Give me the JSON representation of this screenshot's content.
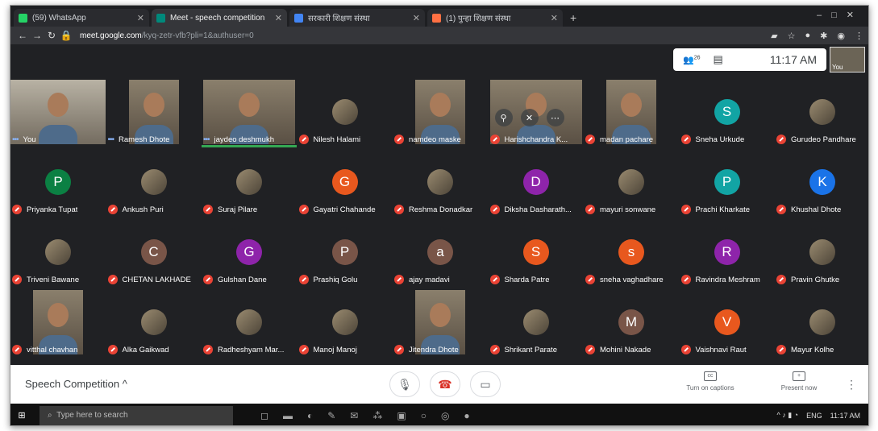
{
  "browser": {
    "tabs": [
      {
        "label": "(59) WhatsApp",
        "color": "#25d366",
        "active": false
      },
      {
        "label": "Meet - speech competition",
        "color": "#00897b",
        "active": true
      },
      {
        "label": "सरकारी शिक्षण संस्था",
        "color": "#4285f4",
        "active": false
      },
      {
        "label": "(1) पुन्हा शिक्षण संस्था",
        "color": "#ff7043",
        "active": false
      }
    ],
    "url_host": "meet.google.com",
    "url_path": "/kyq-zetr-vfb?pli=1&authuser=0"
  },
  "meet": {
    "participant_count": "26",
    "time": "11:17 AM",
    "self_label": "You",
    "meeting_name": "Speech Competition",
    "captions_label": "Turn on captions",
    "present_label": "Present now"
  },
  "participants": [
    {
      "name": "You",
      "kind": "video-wide",
      "status": "dots"
    },
    {
      "name": "Ramesh Dhote",
      "kind": "video",
      "status": "dots"
    },
    {
      "name": "jaydeo deshmukh",
      "kind": "video-mid",
      "status": "dots",
      "speaking": true
    },
    {
      "name": "Nilesh Halami",
      "kind": "avatar-pic",
      "status": "muted"
    },
    {
      "name": "namdeo maske",
      "kind": "video",
      "status": "muted"
    },
    {
      "name": "Harishchandra K...",
      "kind": "video-mid",
      "status": "muted",
      "hover": true
    },
    {
      "name": "madan pachare",
      "kind": "video",
      "status": "muted"
    },
    {
      "name": "Sneha Urkude",
      "kind": "avatar",
      "letter": "S",
      "color": "#12a4a4",
      "status": "muted"
    },
    {
      "name": "Gurudeo Pandhare",
      "kind": "avatar-pic",
      "status": "muted"
    },
    {
      "name": "Priyanka Tupat",
      "kind": "avatar",
      "letter": "P",
      "color": "#0b8043",
      "status": "muted"
    },
    {
      "name": "Ankush Puri",
      "kind": "avatar-pic",
      "status": "muted"
    },
    {
      "name": "Suraj Pilare",
      "kind": "avatar-pic",
      "status": "muted"
    },
    {
      "name": "Gayatri Chahande",
      "kind": "avatar",
      "letter": "G",
      "color": "#e8581e",
      "status": "muted"
    },
    {
      "name": "Reshma Donadkar",
      "kind": "avatar-pic",
      "status": "muted"
    },
    {
      "name": "Diksha Dasharath...",
      "kind": "avatar",
      "letter": "D",
      "color": "#8e24aa",
      "status": "muted"
    },
    {
      "name": "mayuri sonwane",
      "kind": "avatar-pic",
      "status": "muted"
    },
    {
      "name": "Prachi Kharkate",
      "kind": "avatar",
      "letter": "P",
      "color": "#12a4a4",
      "status": "muted"
    },
    {
      "name": "Khushal Dhote",
      "kind": "avatar",
      "letter": "K",
      "color": "#1a73e8",
      "status": "muted"
    },
    {
      "name": "Triveni Bawane",
      "kind": "avatar-pic",
      "status": "muted"
    },
    {
      "name": "CHETAN LAKHADE",
      "kind": "avatar",
      "letter": "C",
      "color": "#795548",
      "status": "muted"
    },
    {
      "name": "Gulshan Dane",
      "kind": "avatar",
      "letter": "G",
      "color": "#8e24aa",
      "status": "muted"
    },
    {
      "name": "Prashiq Golu",
      "kind": "avatar",
      "letter": "P",
      "color": "#795548",
      "status": "muted"
    },
    {
      "name": "ajay madavi",
      "kind": "avatar",
      "letter": "a",
      "color": "#795548",
      "status": "muted"
    },
    {
      "name": "Sharda Patre",
      "kind": "avatar",
      "letter": "S",
      "color": "#e8581e",
      "status": "muted"
    },
    {
      "name": "sneha vaghadhare",
      "kind": "avatar",
      "letter": "s",
      "color": "#e8581e",
      "status": "muted"
    },
    {
      "name": "Ravindra Meshram",
      "kind": "avatar",
      "letter": "R",
      "color": "#8e24aa",
      "status": "muted"
    },
    {
      "name": "Pravin Ghutke",
      "kind": "avatar-pic",
      "status": "muted"
    },
    {
      "name": "vitthal chavhan",
      "kind": "video",
      "status": "muted"
    },
    {
      "name": "Alka Gaikwad",
      "kind": "avatar-pic",
      "status": "muted"
    },
    {
      "name": "Radheshyam Mar...",
      "kind": "avatar-pic",
      "status": "muted"
    },
    {
      "name": "Manoj Manoj",
      "kind": "avatar-pic",
      "status": "muted"
    },
    {
      "name": "Jitendra Dhote",
      "kind": "video",
      "status": "muted"
    },
    {
      "name": "Shrikant Parate",
      "kind": "avatar-pic",
      "status": "muted"
    },
    {
      "name": "Mohini Nakade",
      "kind": "avatar",
      "letter": "M",
      "color": "#795548",
      "status": "muted"
    },
    {
      "name": "Vaishnavi Raut",
      "kind": "avatar",
      "letter": "V",
      "color": "#e8581e",
      "status": "muted"
    },
    {
      "name": "Mayur Kolhe",
      "kind": "avatar-pic",
      "status": "muted"
    }
  ],
  "taskbar": {
    "search_placeholder": "Type here to search",
    "clock": "11:17 AM",
    "lang": "ENG"
  }
}
